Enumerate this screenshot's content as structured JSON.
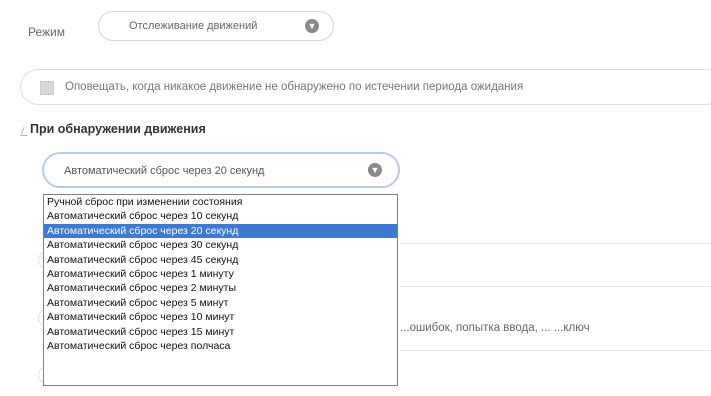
{
  "mode": {
    "label": "Режим",
    "value": "Отслеживание движений"
  },
  "notify": {
    "checked": false,
    "text": "Оповещать, когда никакое движение не обнаружено по истечении периода ожидания"
  },
  "motion_section": {
    "title": "При обнаружении движения",
    "action_value": "Автоматический сброс через 20 секунд",
    "options": [
      "Ручной сброс при изменении состояния",
      "Автоматический сброс через 10 секунд",
      "Автоматический сброс через 20 секунд",
      "Автоматический сброс через 30 секунд",
      "Автоматический сброс через 45 секунд",
      "Автоматический сброс через 1 минуту",
      "Автоматический сброс через 2 минуты",
      "Автоматический сброс через 5 минут",
      "Автоматический сброс через 10 минут",
      "Автоматический сброс через 15 минут",
      "Автоматический сброс через полчаса"
    ],
    "selected_index": 2
  },
  "background_hint": "...ошибок, попытка ввода, ... ...ключ"
}
